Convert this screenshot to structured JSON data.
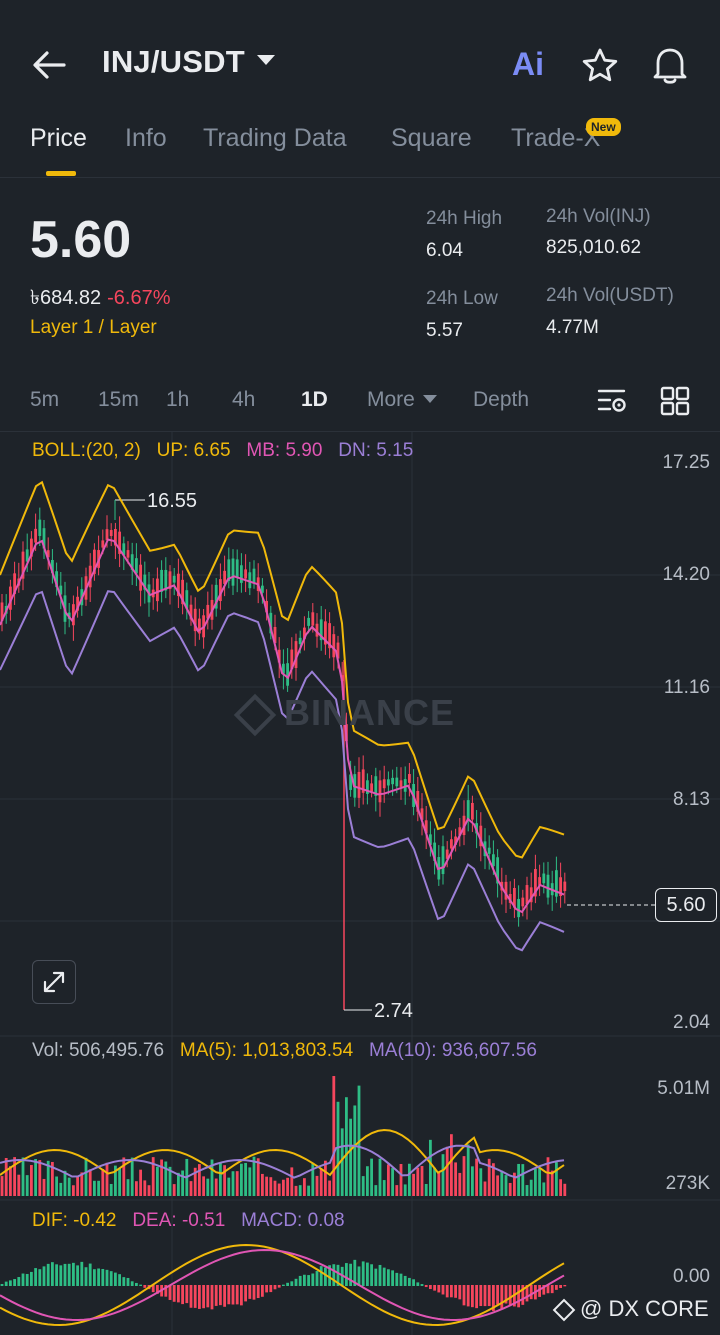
{
  "header": {
    "pair": "INJ/USDT",
    "ai_label": "Ai"
  },
  "tabs": [
    {
      "label": "Price",
      "active": true
    },
    {
      "label": "Info"
    },
    {
      "label": "Trading Data"
    },
    {
      "label": "Square"
    },
    {
      "label": "Trade-X",
      "badge": "New"
    }
  ],
  "ticker": {
    "last_price": "5.60",
    "local_price": "৳684.82",
    "change_pct": "-6.67%",
    "category": "Layer 1 / Layer",
    "high_label": "24h High",
    "high_value": "6.04",
    "low_label": "24h Low",
    "low_value": "5.57",
    "vol_base_label": "24h Vol(INJ)",
    "vol_base_value": "825,010.62",
    "vol_quote_label": "24h Vol(USDT)",
    "vol_quote_value": "4.77M"
  },
  "intervals": [
    "5m",
    "15m",
    "1h",
    "4h",
    "1D",
    "More",
    "Depth"
  ],
  "active_interval": "1D",
  "boll": {
    "label": "BOLL:(20, 2)",
    "up": "UP: 6.65",
    "mb": "MB: 5.90",
    "dn": "DN: 5.15"
  },
  "price_axis": [
    "17.25",
    "14.20",
    "11.16",
    "8.13",
    "5.60",
    "2.04"
  ],
  "annotations": {
    "high": "16.55",
    "low": "2.74"
  },
  "volume": {
    "vol": "Vol: 506,495.76",
    "ma5": "MA(5): 1,013,803.54",
    "ma10": "MA(10): 936,607.56",
    "axis_top": "5.01M",
    "axis_bottom": "273K"
  },
  "macd": {
    "dif": "DIF: -0.42",
    "dea": "DEA: -0.51",
    "macd": "MACD: 0.08",
    "axis_zero": "0.00"
  },
  "watermark": {
    "chart": "BINANCE",
    "corner": "@ DX CORE"
  },
  "colors": {
    "up": "#2ebd85",
    "down": "#f6465d",
    "accent": "#f0b90b",
    "boll_up": "#f0b90b",
    "boll_mb": "#e056b4",
    "boll_dn": "#9b7fd6",
    "background": "#1e2329"
  }
}
